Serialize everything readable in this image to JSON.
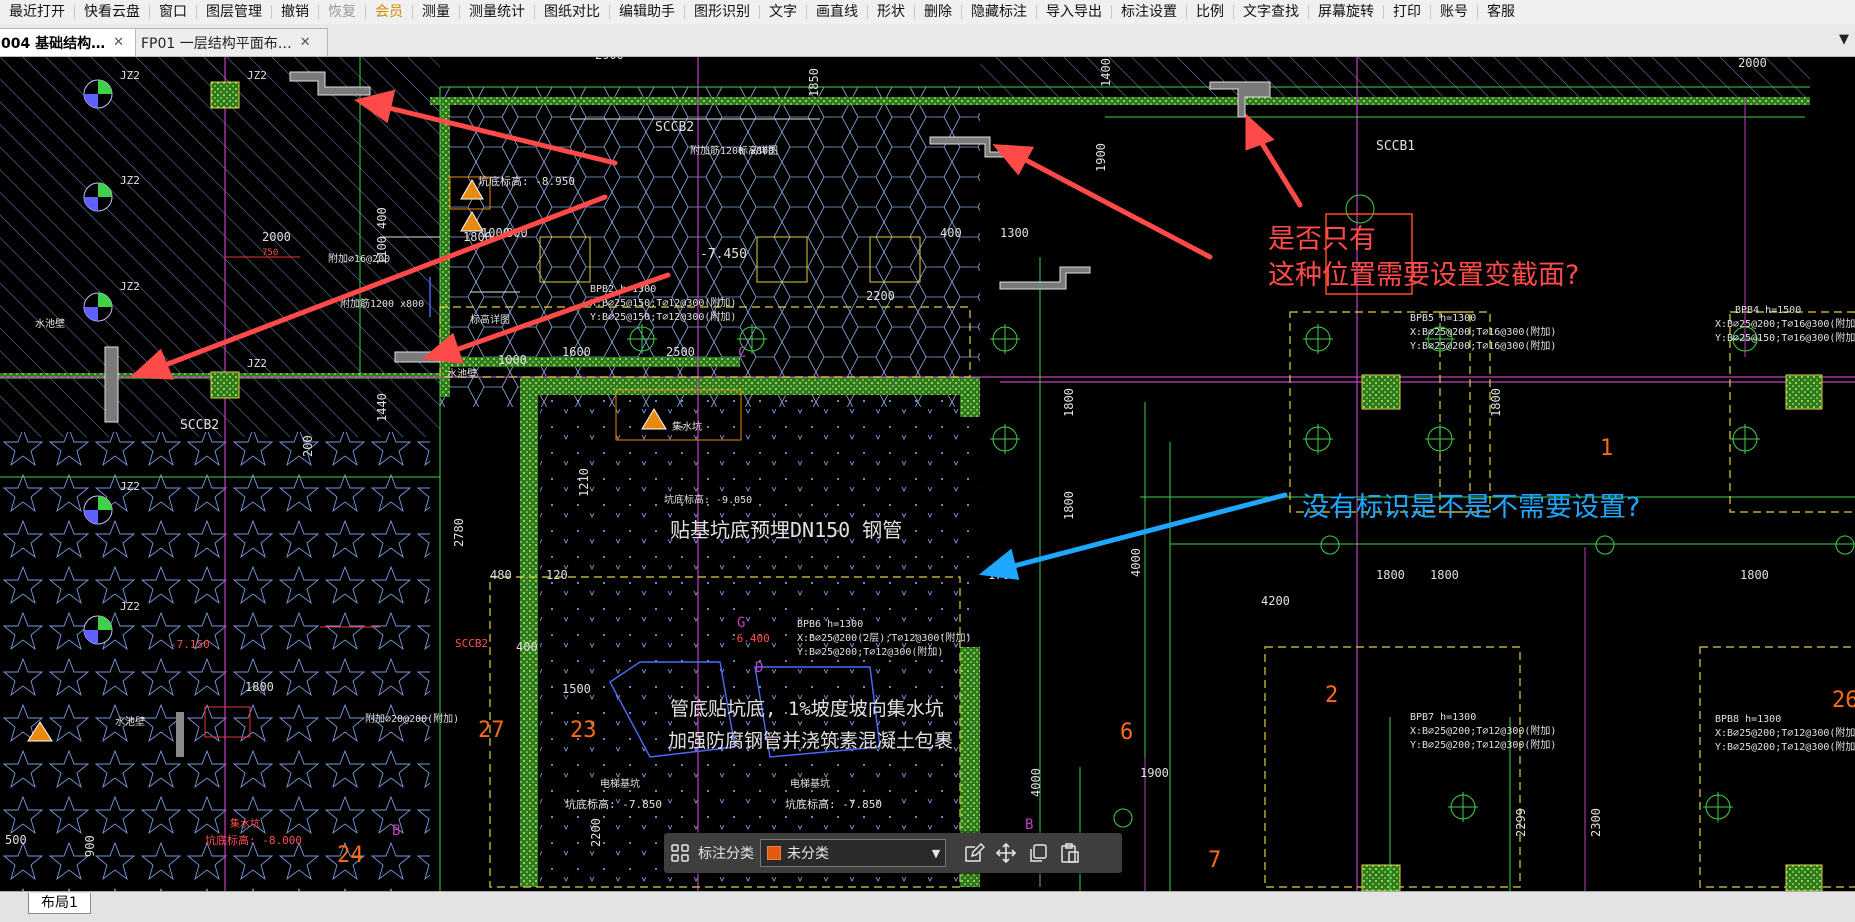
{
  "menu": {
    "items": [
      {
        "label": "最近打开",
        "state": "normal"
      },
      {
        "label": "快看云盘",
        "state": "normal"
      },
      {
        "label": "窗口",
        "state": "normal"
      },
      {
        "label": "图层管理",
        "state": "normal"
      },
      {
        "label": "撤销",
        "state": "normal"
      },
      {
        "label": "恢复",
        "state": "disabled"
      },
      {
        "label": "会员",
        "state": "vip"
      },
      {
        "label": "测量",
        "state": "normal"
      },
      {
        "label": "测量统计",
        "state": "normal"
      },
      {
        "label": "图纸对比",
        "state": "normal"
      },
      {
        "label": "编辑助手",
        "state": "normal"
      },
      {
        "label": "图形识别",
        "state": "normal"
      },
      {
        "label": "文字",
        "state": "normal"
      },
      {
        "label": "画直线",
        "state": "normal"
      },
      {
        "label": "形状",
        "state": "normal"
      },
      {
        "label": "删除",
        "state": "normal"
      },
      {
        "label": "隐藏标注",
        "state": "normal"
      },
      {
        "label": "导入导出",
        "state": "normal"
      },
      {
        "label": "标注设置",
        "state": "normal"
      },
      {
        "label": "比例",
        "state": "normal"
      },
      {
        "label": "文字查找",
        "state": "normal"
      },
      {
        "label": "屏幕旋转",
        "state": "normal"
      },
      {
        "label": "打印",
        "state": "normal"
      },
      {
        "label": "账号",
        "state": "normal"
      },
      {
        "label": "客服",
        "state": "normal"
      }
    ]
  },
  "tabs": [
    {
      "label": "004 基础结构…",
      "close": "✕",
      "active": true
    },
    {
      "label": "FP01 一层结构平面布…",
      "close": "✕",
      "active": false
    }
  ],
  "tab_dropdown": "▼",
  "annotations": {
    "note1_line1": "是否只有",
    "note1_line2": "这种位置需要设置变截面?",
    "note2": "没有标识是不是不需要设置?",
    "note1_color": "#ff4a4a",
    "note2_color": "#1ea7ff"
  },
  "drawing": {
    "labels": {
      "jz2": "JZ2",
      "sccb1": "SCCB1",
      "sccb2": "SCCB2",
      "bpb2_title": "BPB2 h=1300",
      "bpb2_x": "X:B⌀25@150;T⌀12@300(附加)",
      "bpb2_y": "Y:B⌀25@150;T⌀12@300(附加)",
      "bpb4_title": "BPB4 h=1500",
      "bpb4_x": "X:B⌀25@200;T⌀16@300(附加)",
      "bpb4_y": "Y:B⌀25@150;T⌀16@300(附加)",
      "bpb5_title": "BPB5 h=1300",
      "bpb5_x": "X:B⌀25@200;T⌀16@300(附加)",
      "bpb5_y": "Y:B⌀25@200;T⌀16@300(附加)",
      "bpb6_title": "BPB6 h=1300",
      "bpb6_x": "X:B⌀25@200(2层);T⌀12@300(附加)",
      "bpb6_y": "Y:B⌀25@200;T⌀12@300(附加)",
      "bpb7_title": "BPB7 h=1300",
      "bpb7_x": "X:B⌀25@200;T⌀12@300(附加)",
      "bpb7_y": "Y:B⌀25@200;T⌀12@300(附加)",
      "bpb8_title": "BPB8 h=1300",
      "bpb8_x": "X:B⌀25@200;T⌀12@300(附加)",
      "bpb8_y": "Y:B⌀25@200;T⌀12@300(附加)",
      "pipe_note": "贴基坑底预埋DN150 钢管",
      "pipe_note2": "管底贴坑底, 1%坡度坡向集水坑",
      "pipe_note3": "加强防腐钢管并浇筑素混凝土包裹",
      "elev_8950": "坑底标高: -8.950",
      "elev_7450": "-7.450",
      "elev_9050": "坑底标高: -9.050",
      "elev_6400": "-6.400",
      "elev_7850a": "坑底标高: -7.850",
      "elev_7850b": "坑底标高: -7.850",
      "elev_8000": "坑底标高: -8.000",
      "elev_7150": "-7.150",
      "sump": "集水坑",
      "elevator_pit": "电梯基坑",
      "rebar_1200": "附加筋1200 x800",
      "rebar_d16": "附加⌀16@200",
      "rebar_d20": "附加⌀20@200(附加)",
      "waterstop": "标高详图",
      "sccb2_red": "SCCB2",
      "drain": "水池壁",
      "d2900": "2900",
      "d2000a": "2000",
      "d2000b": "2000",
      "d1900a": "1900",
      "d1900b": "1900",
      "d1850": "1850",
      "d1400": "1400",
      "d1300": "1300",
      "d400a": "400",
      "d400b": "400",
      "d400c": "400",
      "d1800a": "1800",
      "d1800b": "1800",
      "d1800c": "1800",
      "d1800d": "1800",
      "d1800e": "1800",
      "d1800f": "1800",
      "d1800g": "1800",
      "d1800h": "1800",
      "d1000a": "1000",
      "d1000b": "1000",
      "d800": "800",
      "d1100": "1100",
      "d1600": "1600",
      "d2500": "2500",
      "d2200a": "2200",
      "d2200b": "2200",
      "d2780": "2780",
      "d480": "480",
      "d120": "120",
      "d1700": "1700",
      "d4000a": "4000",
      "d4000b": "4000",
      "d4200": "4200",
      "d1500a": "1500",
      "d1500b": "1500",
      "d2299": "2299",
      "d2300": "2300",
      "d900": "900",
      "d500": "500",
      "d1210": "1210",
      "d750": "750",
      "d1440": "1440",
      "d200": "200",
      "n1": "1",
      "n2": "2",
      "n6": "6",
      "n7": "7",
      "n23": "23",
      "n24": "24",
      "n26": "26",
      "n27": "27",
      "lblB1": "B",
      "lblB2": "B",
      "lblC": "C",
      "lblG": "G",
      "lblD": "D"
    }
  },
  "float_toolbar": {
    "group_icon": "grid-icon",
    "label": "标注分类",
    "select_value": "未分类",
    "select_arrow": "▼",
    "swatch_color": "#e35a12",
    "buttons": [
      "edit-icon",
      "move-icon",
      "copy-icon",
      "paste-icon"
    ]
  },
  "layout_tab": "布局1"
}
